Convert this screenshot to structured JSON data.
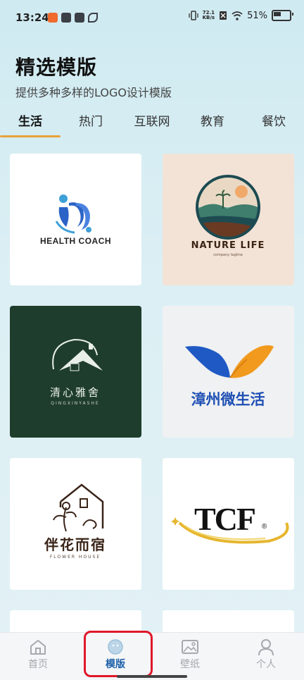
{
  "status_bar": {
    "time": "13:24",
    "speed_value": "72.1",
    "speed_unit": "KB/s",
    "battery": "51%"
  },
  "header": {
    "title": "精选模版",
    "subtitle": "提供多种多样的LOGO设计模版"
  },
  "tabs": [
    {
      "label": "生活",
      "active": true
    },
    {
      "label": "热门",
      "active": false
    },
    {
      "label": "互联网",
      "active": false
    },
    {
      "label": "教育",
      "active": false
    },
    {
      "label": "餐饮",
      "active": false
    }
  ],
  "cards": [
    {
      "logo_text": "HEALTH COACH",
      "background": "#ffffff"
    },
    {
      "logo_text": "NATURE LIFE",
      "logo_subtext": "company tagline",
      "background": "#f3e3d6"
    },
    {
      "logo_text": "清心雅舍",
      "logo_subtext": "QINGXINYASHE",
      "background": "#1f3d2c"
    },
    {
      "logo_text": "漳州微生活",
      "background": "#eff1f2"
    },
    {
      "logo_text": "伴花而宿",
      "logo_subtext": "FLOWER HOUSE",
      "background": "#ffffff"
    },
    {
      "logo_text": "TCF",
      "logo_mark": "®",
      "background": "#ffffff"
    }
  ],
  "bottom_nav": [
    {
      "label": "首页",
      "icon": "home-icon",
      "active": false
    },
    {
      "label": "模版",
      "icon": "template-icon",
      "active": true
    },
    {
      "label": "壁纸",
      "icon": "wallpaper-icon",
      "active": false
    },
    {
      "label": "个人",
      "icon": "person-icon",
      "active": false
    }
  ],
  "colors": {
    "accent": "#e8a33a",
    "nav_active": "#1c5fa8",
    "highlight": "#e0182a"
  }
}
